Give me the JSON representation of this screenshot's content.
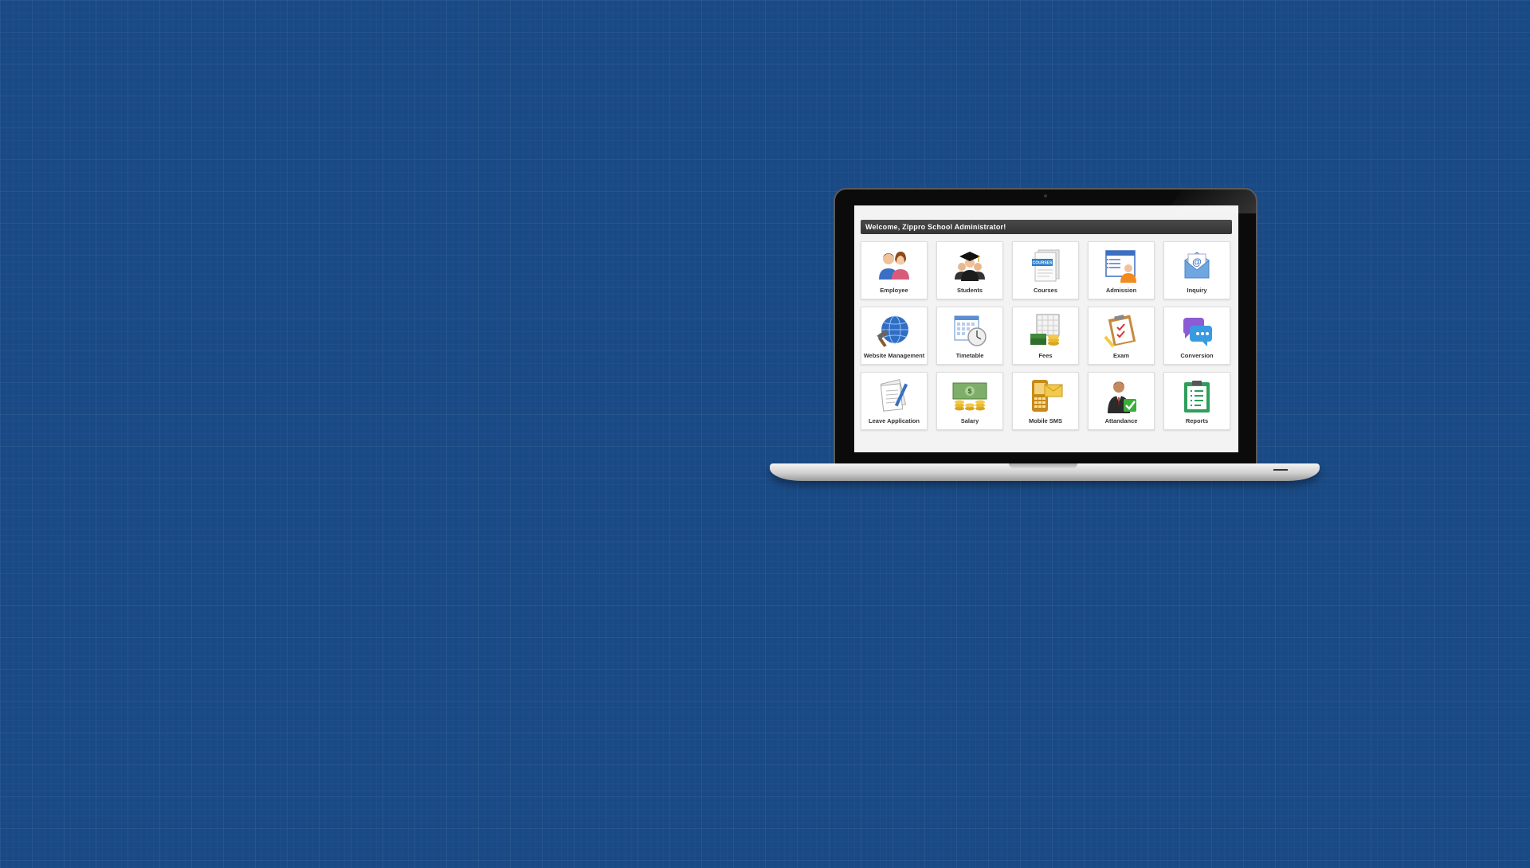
{
  "dashboard": {
    "welcome": "Welcome, Zippro School Administrator!",
    "modules": [
      {
        "label": "Employee",
        "icon": "employee-icon"
      },
      {
        "label": "Students",
        "icon": "students-icon"
      },
      {
        "label": "Courses",
        "icon": "courses-icon",
        "badge": "COURSES"
      },
      {
        "label": "Admission",
        "icon": "admission-icon"
      },
      {
        "label": "Inquiry",
        "icon": "inquiry-icon"
      },
      {
        "label": "Website Management",
        "icon": "website-management-icon"
      },
      {
        "label": "Timetable",
        "icon": "timetable-icon"
      },
      {
        "label": "Fees",
        "icon": "fees-icon"
      },
      {
        "label": "Exam",
        "icon": "exam-icon"
      },
      {
        "label": "Conversion",
        "icon": "conversion-icon"
      },
      {
        "label": "Leave Application",
        "icon": "leave-application-icon"
      },
      {
        "label": "Salary",
        "icon": "salary-icon"
      },
      {
        "label": "Mobile SMS",
        "icon": "mobile-sms-icon"
      },
      {
        "label": "Attandance",
        "icon": "attendance-icon"
      },
      {
        "label": "Reports",
        "icon": "reports-icon"
      }
    ]
  },
  "colors": {
    "background": "#1a4a85",
    "header_bar": "#3a3a3a",
    "tile_bg": "#ffffff"
  }
}
